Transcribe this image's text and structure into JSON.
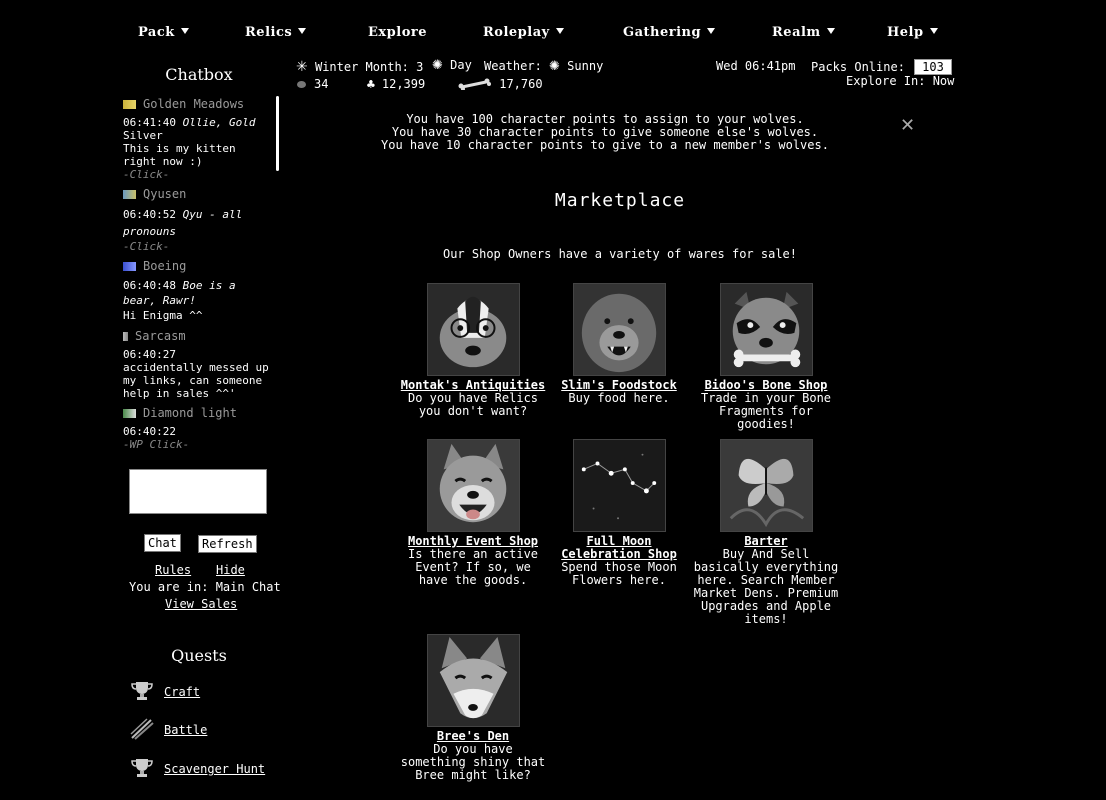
{
  "nav": [
    {
      "label": "Pack",
      "dropdown": true
    },
    {
      "label": "Relics",
      "dropdown": true
    },
    {
      "label": "Explore",
      "dropdown": false
    },
    {
      "label": "Roleplay",
      "dropdown": true
    },
    {
      "label": "Gathering",
      "dropdown": true
    },
    {
      "label": "Realm",
      "dropdown": true
    },
    {
      "label": "Help",
      "dropdown": true
    }
  ],
  "chatbox": {
    "title": "Chatbox",
    "entries": [
      {
        "user": "Golden Meadows",
        "flag_colors": [
          "#c9b23a",
          "#e8d56a"
        ],
        "time": "06:41:40",
        "msg_italic": "Ollie, Gold",
        "msg": "Silver\nThis is my kitten right now :)",
        "click": "-Click-"
      },
      {
        "user": "Qyusen",
        "flag_colors": [
          "#6a9ac0",
          "#c9c06a"
        ],
        "time": "06:40:52",
        "msg_italic": "Qyu - all pronouns",
        "msg": "",
        "click": "-Click-"
      },
      {
        "user": "Boeing",
        "flag_colors": [
          "#3a4fd0",
          "#8899ff"
        ],
        "time": "06:40:48",
        "msg_italic": "Boe is a bear, Rawr!",
        "msg": "Hi Enigma ^^",
        "click": ""
      },
      {
        "user": "Sarcasm",
        "flag_colors": [
          "#bbbbbb",
          "#888888"
        ],
        "time": "06:40:27",
        "msg_italic": "",
        "msg": "accidentally messed up my links, can someone help in sales ^^'",
        "click": ""
      },
      {
        "user": "Diamond light",
        "flag_colors": [
          "#4a8a4a",
          "#dddddd"
        ],
        "time": "06:40:22",
        "msg_italic": "",
        "msg": "",
        "click": "-WP Click-"
      }
    ],
    "chat_button": "Chat",
    "refresh_button": "Refresh",
    "rules_link": "Rules",
    "hide_link": "Hide",
    "location_text": "You are in: Main Chat",
    "view_sales_link": "View Sales"
  },
  "quests": {
    "title": "Quests",
    "items": [
      {
        "label": "Craft",
        "icon": "trophy-icon"
      },
      {
        "label": "Battle",
        "icon": "claw-icon"
      },
      {
        "label": "Scavenger Hunt",
        "icon": "trophy-icon"
      }
    ]
  },
  "status": {
    "season": "Winter Month: 3",
    "time_of_day": "Day",
    "weather_label": "Weather:",
    "weather": "Sunny",
    "stones": "34",
    "herbs": "12,399",
    "bones": "17,760",
    "datetime": "Wed 06:41pm",
    "packs_online_label": "Packs Online:",
    "packs_online": "103",
    "explore_in": "Explore In: Now"
  },
  "notices": [
    "You have 100 character points to assign to your wolves.",
    "You have 30 character points to give someone else's wolves.",
    "You have 10 character points to give to a new member's wolves."
  ],
  "close_symbol": "✕",
  "market": {
    "title": "Marketplace",
    "subtitle": "Our Shop Owners have a variety of wares for sale!",
    "shops": [
      {
        "name": "Montak's Antiquities",
        "desc": "Do you have Relics you don't want?",
        "icon": "badger-icon"
      },
      {
        "name": "Slim's Foodstock",
        "desc": "Buy food here.",
        "icon": "bear-icon"
      },
      {
        "name": "Bidoo's Bone Shop",
        "desc": "Trade in your Bone Fragments for goodies!",
        "icon": "raccoon-icon"
      },
      {
        "name": "Monthly Event Shop",
        "desc": "Is there an active Event? If so, we have the goods.",
        "icon": "shiba-icon"
      },
      {
        "name": "Full Moon Celebration Shop",
        "desc": "Spend those Moon Flowers here.",
        "icon": "constellation-icon"
      },
      {
        "name": "Barter",
        "desc": "Buy And Sell basically everything here. Search Member Market Dens. Premium Upgrades and Apple items!",
        "icon": "butterfly-icon"
      },
      {
        "name": "Bree's Den",
        "desc": "Do you have something shiny that Bree might like?",
        "icon": "fox-icon"
      }
    ]
  }
}
